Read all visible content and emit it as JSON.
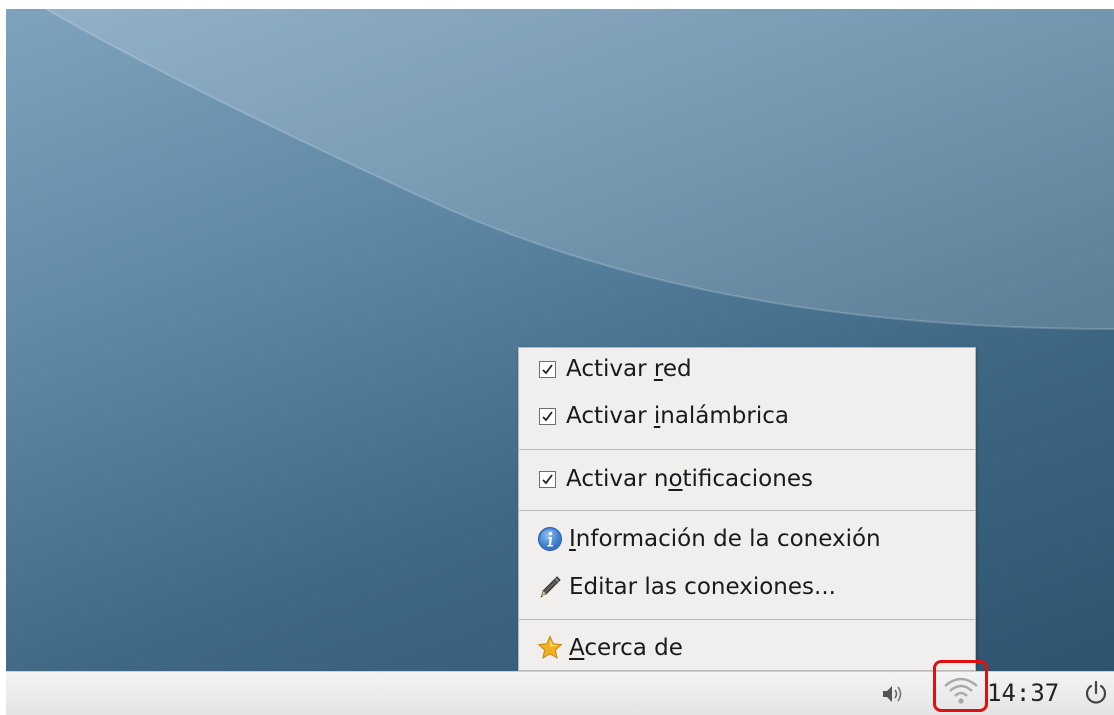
{
  "menu": {
    "items": [
      {
        "prefix": "Activar ",
        "mnemonic": "r",
        "suffix": "ed",
        "checked": true,
        "icon": "checkbox"
      },
      {
        "prefix": "Activar ",
        "mnemonic": "i",
        "suffix": "nalámbrica",
        "checked": true,
        "icon": "checkbox"
      },
      {
        "prefix": "Activar n",
        "mnemonic": "o",
        "suffix": "tificaciones",
        "checked": true,
        "icon": "checkbox"
      },
      {
        "prefix": "",
        "mnemonic": "I",
        "suffix": "nformación de la conexión",
        "icon": "info-icon"
      },
      {
        "prefix": "Editar las conexiones...",
        "mnemonic": "",
        "suffix": "",
        "icon": "pencil-icon"
      },
      {
        "prefix": "",
        "mnemonic": "A",
        "suffix": "cerca de",
        "icon": "star-icon"
      }
    ]
  },
  "taskbar": {
    "clock": "14:37",
    "tray_icons": [
      "volume-icon",
      "wifi-icon",
      "power-icon"
    ]
  },
  "colors": {
    "highlight": "#e01010",
    "menu_background": "#f0efee",
    "info_icon": "#3b7fd0",
    "star_icon": "#f2b01e"
  }
}
